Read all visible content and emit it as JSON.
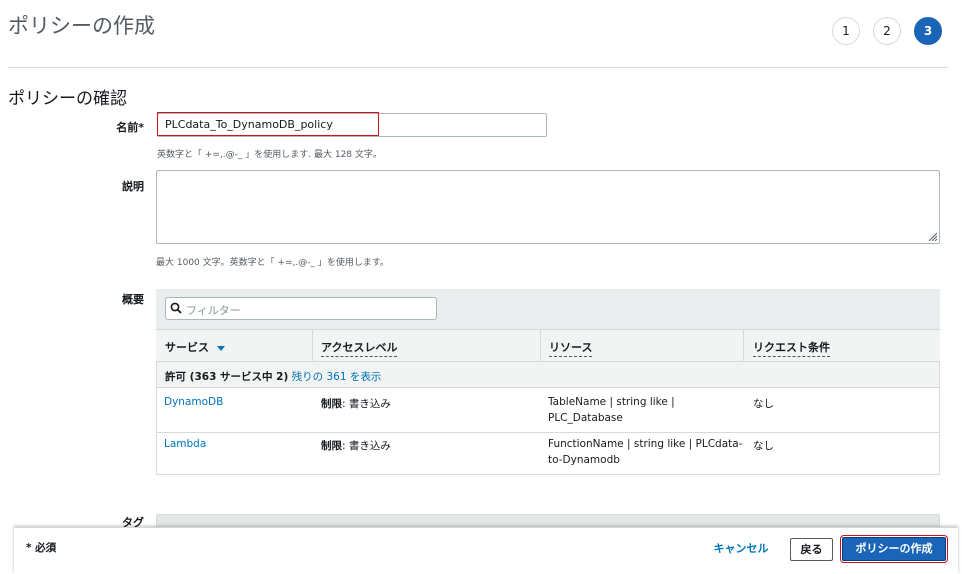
{
  "header": {
    "title": "ポリシーの作成",
    "steps": [
      "1",
      "2",
      "3"
    ],
    "active_step": "3"
  },
  "review": {
    "section_title": "ポリシーの確認",
    "name_label": "名前*",
    "name_value": "PLCdata_To_DynamoDB_policy",
    "name_hint": "英数字と「 +=,.@-_ 」を使用します. 最大 128 文字。",
    "description_label": "説明",
    "description_value": "",
    "description_hint": "最大 1000 文字。英数字と「 +=,.@-_ 」を使用します。",
    "summary_label": "概要",
    "tags_label": "タグ"
  },
  "summary": {
    "filter_placeholder": "フィルター",
    "columns": [
      "サービス",
      "アクセスレベル",
      "リソース",
      "リクエスト条件"
    ],
    "group_prefix": "許可 (363 サービス中 2)",
    "group_link": "残りの 361 を表示",
    "rows": [
      {
        "service": "DynamoDB",
        "access_bold": "制限",
        "access_rest": ": 書き込み",
        "resource_line1": "TableName | string like |",
        "resource_line2": "PLC_Database",
        "condition": "なし"
      },
      {
        "service": "Lambda",
        "access_bold": "制限",
        "access_rest": ": 書き込み",
        "resource_line1": "FunctionName | string like | PLCdata-",
        "resource_line2": "to-Dynamodb",
        "condition": "なし"
      }
    ]
  },
  "footer": {
    "required_note": "* 必須",
    "cancel_label": "キャンセル",
    "back_label": "戻る",
    "create_label": "ポリシーの作成"
  },
  "colors": {
    "primary": "#1a65b7",
    "link": "#0073bb",
    "highlight_border": "#d1121e"
  }
}
